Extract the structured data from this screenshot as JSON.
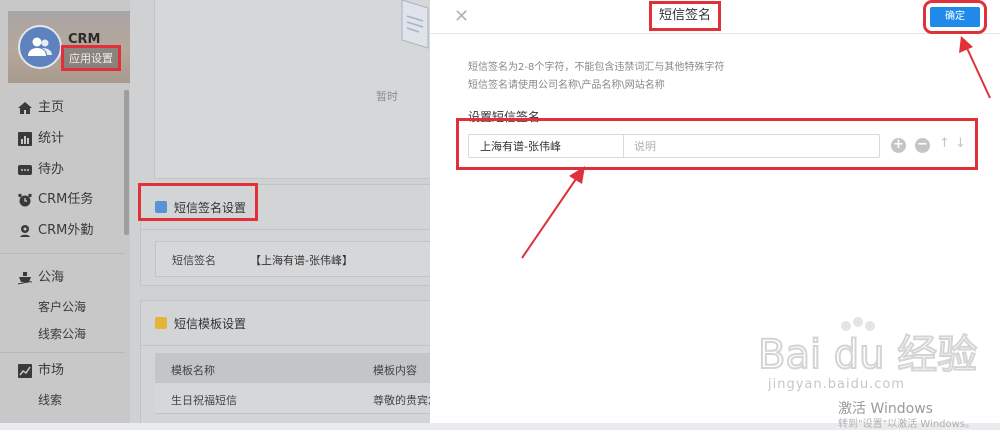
{
  "sidebar": {
    "app_name": "CRM",
    "app_settings_label": "应用设置",
    "items": [
      {
        "label": "主页",
        "icon": "home-icon"
      },
      {
        "label": "统计",
        "icon": "bar-chart-icon"
      },
      {
        "label": "待办",
        "icon": "ellipsis-icon"
      },
      {
        "label": "CRM任务",
        "icon": "alarm-clock-icon"
      },
      {
        "label": "CRM外勤",
        "icon": "location-icon"
      },
      {
        "label": "公海",
        "icon": "ship-icon"
      },
      {
        "label": "客户公海",
        "icon": ""
      },
      {
        "label": "线索公海",
        "icon": ""
      },
      {
        "label": "市场",
        "icon": "trend-icon"
      },
      {
        "label": "线索",
        "icon": ""
      }
    ]
  },
  "background": {
    "empty_text": "暂时",
    "sms_signature_section": {
      "title": "短信签名设置",
      "key": "短信签名",
      "value": "【上海有谱-张伟峰】"
    },
    "sms_template_section": {
      "title": "短信模板设置",
      "columns": [
        "模板名称",
        "模板内容"
      ],
      "rows": [
        [
          "生日祝福短信",
          "尊敬的贵宾您"
        ]
      ]
    }
  },
  "modal": {
    "title": "短信签名",
    "confirm_label": "确定",
    "hints": [
      "短信签名为2-8个字符，不能包含违禁词汇与其他特殊字符",
      "短信签名请使用公司名称\\产品名称\\网站名称"
    ],
    "field_label": "设置短信签名",
    "signature_value": "上海有谱-张伟峰",
    "description_placeholder": "说明"
  },
  "watermark": {
    "brand": "Bai du 经验",
    "url": "jingyan.baidu.com",
    "windows_activate": "激活 Windows",
    "windows_activate_sub": "转到\"设置\"以激活 Windows。"
  },
  "colors": {
    "accent": "#1f8ae8",
    "annotation_red": "#e0313a"
  }
}
